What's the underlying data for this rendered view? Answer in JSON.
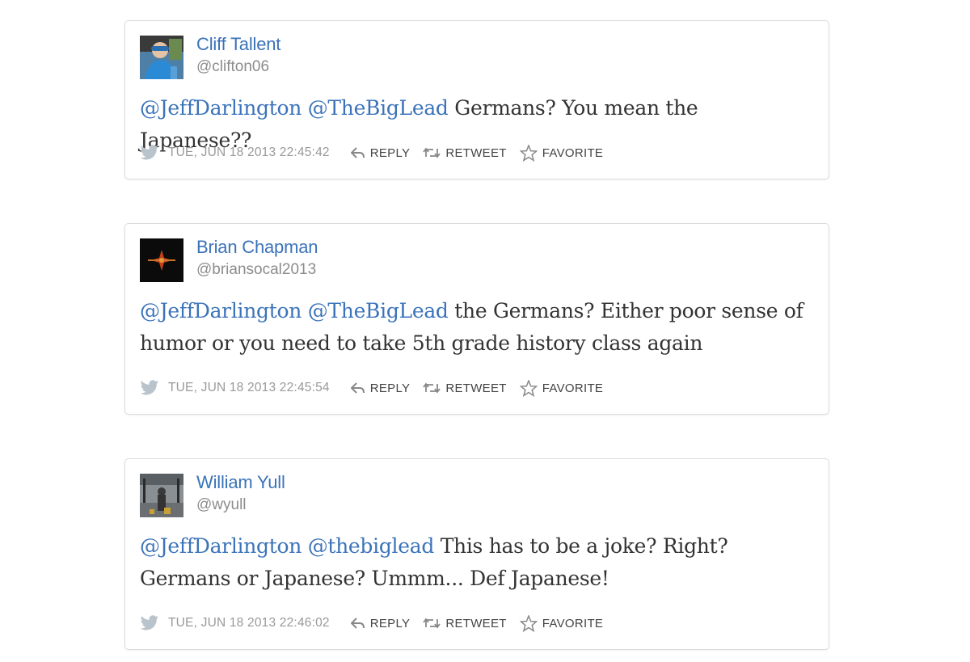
{
  "tweets": [
    {
      "name": "Cliff Tallent",
      "handle": "@clifton06",
      "mentions": [
        "@JeffDarlington",
        "@TheBigLead"
      ],
      "text": "Germans? You mean the Japanese??",
      "timestamp": "TUE, JUN 18 2013 22:45:42",
      "avatar_icon": "avatar-photo-person"
    },
    {
      "name": "Brian Chapman",
      "handle": "@briansocal2013",
      "mentions": [
        "@JeffDarlington",
        "@TheBigLead"
      ],
      "text": "the Germans? Either poor sense of humor or you need to take 5th grade history class again",
      "timestamp": "TUE, JUN 18 2013 22:45:54",
      "avatar_icon": "avatar-dark-logo"
    },
    {
      "name": "William Yull",
      "handle": "@wyull",
      "mentions": [
        "@JeffDarlington",
        "@thebiglead"
      ],
      "text": "This has to be a joke? Right? Germans or Japanese? Ummm... Def Japanese!",
      "timestamp": "TUE, JUN 18 2013 22:46:02",
      "avatar_icon": "avatar-photo-scene"
    }
  ],
  "actions": {
    "reply": "REPLY",
    "retweet": "RETWEET",
    "favorite": "FAVORITE"
  },
  "colors": {
    "link": "#3b73b9",
    "meta": "#999999",
    "text": "#333333"
  }
}
